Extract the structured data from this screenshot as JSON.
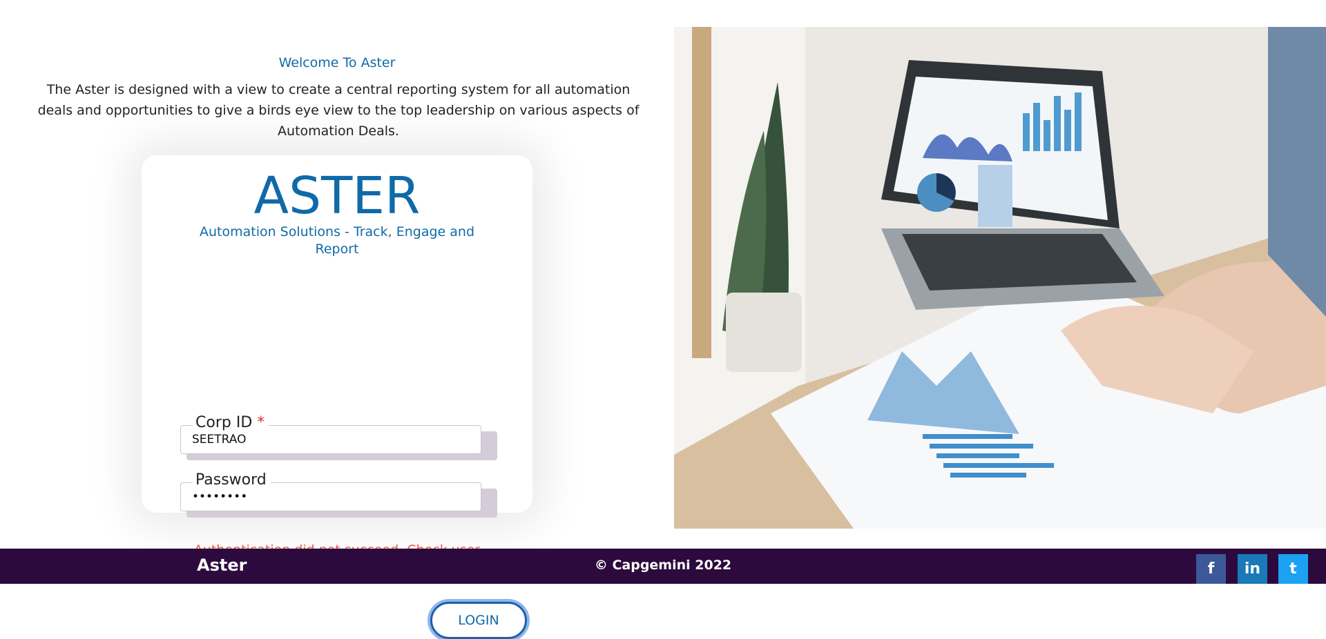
{
  "welcome": {
    "title": "Welcome To Aster",
    "description": "The Aster is designed with a view to create a central reporting system for all automation deals and opportunities to give a birds eye view to the top leadership on various aspects of Automation Deals."
  },
  "login_card": {
    "brand": "ASTER",
    "tagline": "Automation Solutions - Track, Engage and Report",
    "corp_id": {
      "label": "Corp ID",
      "required_mark": "*",
      "value": "SEETRAO"
    },
    "password": {
      "label": "Password",
      "value": "••••••••"
    },
    "error_message": "Authentication did not succeed. Check user name and password.",
    "login_button": "LOGIN"
  },
  "footer": {
    "brand": "Aster",
    "copyright": "© Capgemini 2022",
    "social": [
      {
        "name": "facebook",
        "glyph": "f",
        "color": "#3b5998"
      },
      {
        "name": "linkedin",
        "glyph": "in",
        "color": "#1a79b9"
      },
      {
        "name": "twitter",
        "glyph": "t",
        "color": "#1da1f2"
      }
    ]
  },
  "colors": {
    "accent": "#0f6aa8",
    "error": "#f0553d",
    "footer_bg": "#2c0a3d"
  }
}
